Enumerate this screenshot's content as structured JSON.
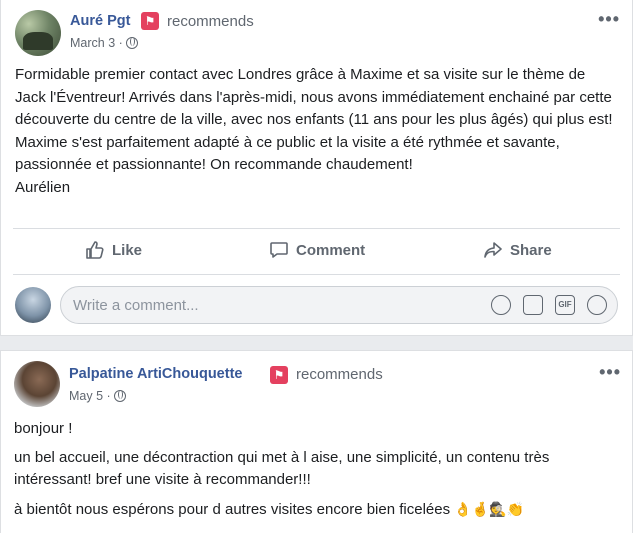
{
  "post1": {
    "author": "Auré Pgt",
    "badge_icon": "recommend-flag-icon",
    "action": "recommends",
    "date": "March 3 ·",
    "body": "Formidable premier contact avec Londres grâce à Maxime et sa visite sur le thème de Jack l'Éventreur! Arrivés dans l'après-midi, nous avons immédiatement enchainé par cette découverte du centre de la ville, avec nos enfants (11 ans pour les plus âgés) qui plus est! Maxime s'est parfaitement adapté à ce public et la visite a été rythmée et savante, passionnée et passionnante! On recommande chaudement!",
    "signature": "Aurélien",
    "actions": {
      "like": "Like",
      "comment": "Comment",
      "share": "Share"
    },
    "comment_placeholder": "Write a comment..."
  },
  "post2": {
    "author": "Palpatine ArtiChouquette",
    "action": "recommends",
    "date": "May 5 ·",
    "lines": [
      "bonjour !",
      "un bel accueil, une décontraction qui met à l aise, une simplicité, un contenu très intéressant! bref une visite à recommander!!!",
      "à bientôt nous espérons pour d autres visites encore bien ficelées"
    ],
    "emojis": "👌🤞🕵👏"
  },
  "colors": {
    "author": "#385898",
    "badge": "#e4405f",
    "muted": "#606770",
    "background": "#e9ebee"
  }
}
